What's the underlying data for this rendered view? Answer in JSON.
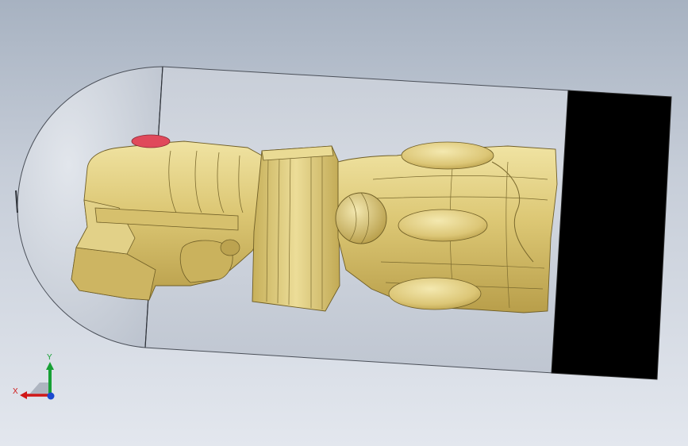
{
  "viewport": {
    "background_top": "#a7b2c1",
    "background_bottom": "#e3e7ee"
  },
  "model": {
    "capsule_color": "#c8ced8",
    "part_color": "#d8c46f",
    "part_highlight": "#eadb94",
    "part_shadow": "#a9903d",
    "cap_color": "#000000",
    "marker_color": "#e0495b"
  },
  "triad": {
    "x_label": "X",
    "y_label": "Y",
    "x_color": "#d01818",
    "y_color": "#17a035",
    "z_color": "#1b49d0"
  }
}
